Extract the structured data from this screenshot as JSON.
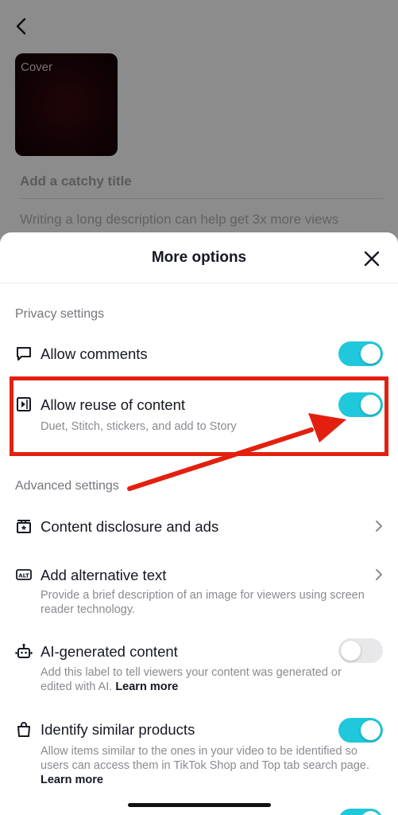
{
  "background_page": {
    "cover_label": "Cover",
    "title_placeholder": "Add a catchy title",
    "description_placeholder": "Writing a long description can help get 3x more views"
  },
  "sheet": {
    "title": "More options",
    "privacy_section_label": "Privacy settings",
    "advanced_section_label": "Advanced settings",
    "rows": {
      "allow_comments": {
        "title": "Allow comments",
        "icon": "comment-icon",
        "enabled": true
      },
      "allow_reuse": {
        "title": "Allow reuse of content",
        "subtitle": "Duet, Stitch, stickers, and add to Story",
        "icon": "play-square-icon",
        "enabled": true
      },
      "content_disclosure": {
        "title": "Content disclosure and ads",
        "icon": "star-clapper-icon"
      },
      "alt_text": {
        "title": "Add alternative text",
        "subtitle": "Provide a brief description of an image for viewers using screen reader technology.",
        "icon": "alt-icon"
      },
      "ai_generated": {
        "title": "AI-generated content",
        "subtitle": "Add this label to tell viewers your content was generated or edited with AI.",
        "learn_more": "Learn more",
        "icon": "robot-icon",
        "enabled": false
      },
      "similar_products": {
        "title": "Identify similar products",
        "subtitle": "Allow items similar to the ones in your video to be identified so users can access them in TikTok Shop and Top tab search page.",
        "learn_more": "Learn more",
        "icon": "shopping-bag-icon",
        "enabled": true
      }
    }
  },
  "colors": {
    "toggle_on": "#20c8dc",
    "toggle_off": "#e8e8ea",
    "annotation_red": "#e3200f",
    "text_primary": "#161823",
    "text_secondary": "#8a8a91"
  }
}
